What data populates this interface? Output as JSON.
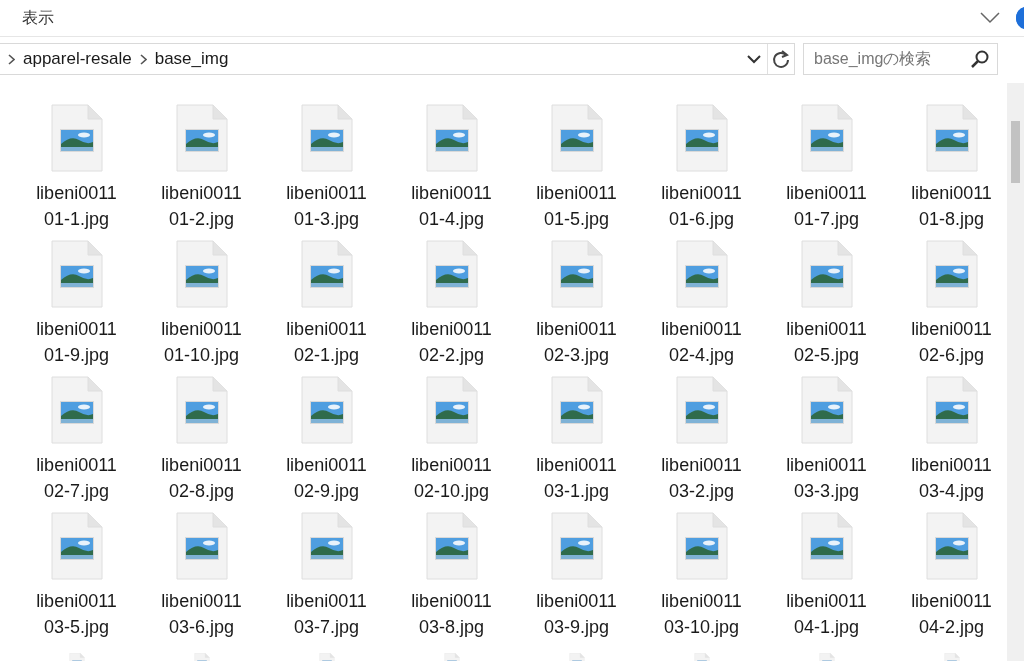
{
  "ribbon": {
    "tab": "表示"
  },
  "address": {
    "crumbs": [
      "apparel-resale",
      "base_img"
    ]
  },
  "search": {
    "placeholder": "base_imgの検索"
  },
  "files": [
    {
      "kind": "file",
      "name": "libeni001101-1.jpg"
    },
    {
      "kind": "file",
      "name": "libeni001101-2.jpg"
    },
    {
      "kind": "file",
      "name": "libeni001101-3.jpg"
    },
    {
      "kind": "file",
      "name": "libeni001101-4.jpg"
    },
    {
      "kind": "file",
      "name": "libeni001101-5.jpg"
    },
    {
      "kind": "file",
      "name": "libeni001101-6.jpg"
    },
    {
      "kind": "file",
      "name": "libeni001101-7.jpg"
    },
    {
      "kind": "file",
      "name": "libeni001101-8.jpg"
    },
    {
      "kind": "file",
      "name": "libeni001101-9.jpg"
    },
    {
      "kind": "file",
      "name": "libeni001101-10.jpg"
    },
    {
      "kind": "file",
      "name": "libeni001102-1.jpg"
    },
    {
      "kind": "file",
      "name": "libeni001102-2.jpg"
    },
    {
      "kind": "file",
      "name": "libeni001102-3.jpg"
    },
    {
      "kind": "file",
      "name": "libeni001102-4.jpg"
    },
    {
      "kind": "file",
      "name": "libeni001102-5.jpg"
    },
    {
      "kind": "file",
      "name": "libeni001102-6.jpg"
    },
    {
      "kind": "file",
      "name": "libeni001102-7.jpg"
    },
    {
      "kind": "file",
      "name": "libeni001102-8.jpg"
    },
    {
      "kind": "file",
      "name": "libeni001102-9.jpg"
    },
    {
      "kind": "file",
      "name": "libeni001102-10.jpg"
    },
    {
      "kind": "file",
      "name": "libeni001103-1.jpg"
    },
    {
      "kind": "file",
      "name": "libeni001103-2.jpg"
    },
    {
      "kind": "file",
      "name": "libeni001103-3.jpg"
    },
    {
      "kind": "file",
      "name": "libeni001103-4.jpg"
    },
    {
      "kind": "file",
      "name": "libeni001103-5.jpg"
    },
    {
      "kind": "file",
      "name": "libeni001103-6.jpg"
    },
    {
      "kind": "file",
      "name": "libeni001103-7.jpg"
    },
    {
      "kind": "file",
      "name": "libeni001103-8.jpg"
    },
    {
      "kind": "file",
      "name": "libeni001103-9.jpg"
    },
    {
      "kind": "file",
      "name": "libeni001103-10.jpg"
    },
    {
      "kind": "file",
      "name": "libeni001104-1.jpg"
    },
    {
      "kind": "file",
      "name": "libeni001104-2.jpg"
    },
    {
      "kind": "partial"
    },
    {
      "kind": "partial"
    },
    {
      "kind": "partial"
    },
    {
      "kind": "partial"
    },
    {
      "kind": "partial"
    },
    {
      "kind": "partial"
    },
    {
      "kind": "partial"
    },
    {
      "kind": "partial"
    }
  ]
}
